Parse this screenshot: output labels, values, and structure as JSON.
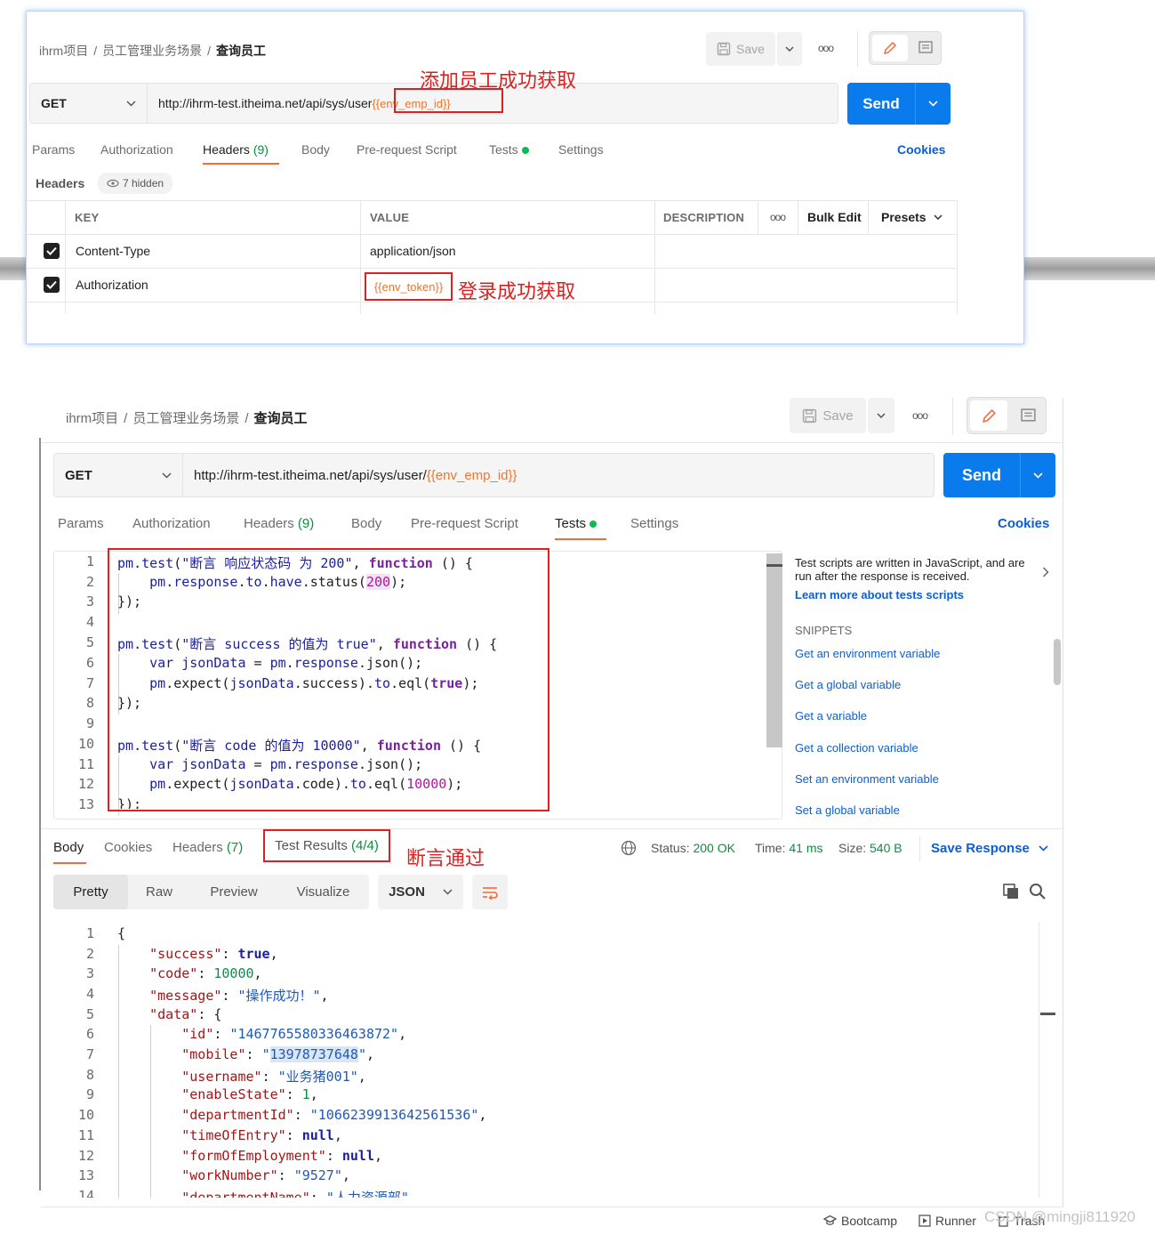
{
  "annotations": {
    "add_emp": "添加员工成功获取",
    "login": "登录成功获取",
    "assert_pass": "断言通过"
  },
  "breadcrumb": {
    "project": "ihrm项目",
    "folder": "员工管理业务场景",
    "current": "查询员工"
  },
  "toolbar": {
    "save_label": "Save",
    "more": "ooo"
  },
  "request": {
    "method": "GET",
    "url_base": "http://ihrm-test.itheima.net/api/sys/user",
    "url_base2": "http://ihrm-test.itheima.net/api/sys/user/",
    "url_var": "{{env_emp_id}}",
    "send_label": "Send"
  },
  "tabs": {
    "params": "Params",
    "authorization": "Authorization",
    "headers": "Headers",
    "headers_count": "(9)",
    "body": "Body",
    "prerequest": "Pre-request Script",
    "tests": "Tests",
    "settings": "Settings",
    "cookies": "Cookies"
  },
  "headers_section": {
    "title": "Headers",
    "hidden": "7 hidden",
    "col_key": "KEY",
    "col_value": "VALUE",
    "col_desc": "DESCRIPTION",
    "bulk_edit": "Bulk Edit",
    "presets": "Presets",
    "rows": [
      {
        "key": "Content-Type",
        "value": "application/json"
      },
      {
        "key": "Authorization",
        "value": "{{env_token}}"
      }
    ]
  },
  "tests_panel": {
    "info": "Test scripts are written in JavaScript, and are run after the response is received.",
    "learn_more": "Learn more about tests scripts",
    "snippets_title": "SNIPPETS",
    "snippets": [
      "Get an environment variable",
      "Get a global variable",
      "Get a variable",
      "Get a collection variable",
      "Set an environment variable",
      "Set a global variable"
    ]
  },
  "response": {
    "tabs": {
      "body": "Body",
      "cookies": "Cookies",
      "headers": "Headers",
      "headers_count": "(7)",
      "test_results": "Test Results",
      "test_count": "(4/4)"
    },
    "status_label": "Status:",
    "status_value": "200 OK",
    "time_label": "Time:",
    "time_value": "41 ms",
    "size_label": "Size:",
    "size_value": "540 B",
    "save_response": "Save Response",
    "views": [
      "Pretty",
      "Raw",
      "Preview",
      "Visualize"
    ],
    "format": "JSON"
  },
  "footer": {
    "bootcamp": "Bootcamp",
    "runner": "Runner",
    "trash": "Trash",
    "watermark": "CSDN @mingji811920"
  }
}
